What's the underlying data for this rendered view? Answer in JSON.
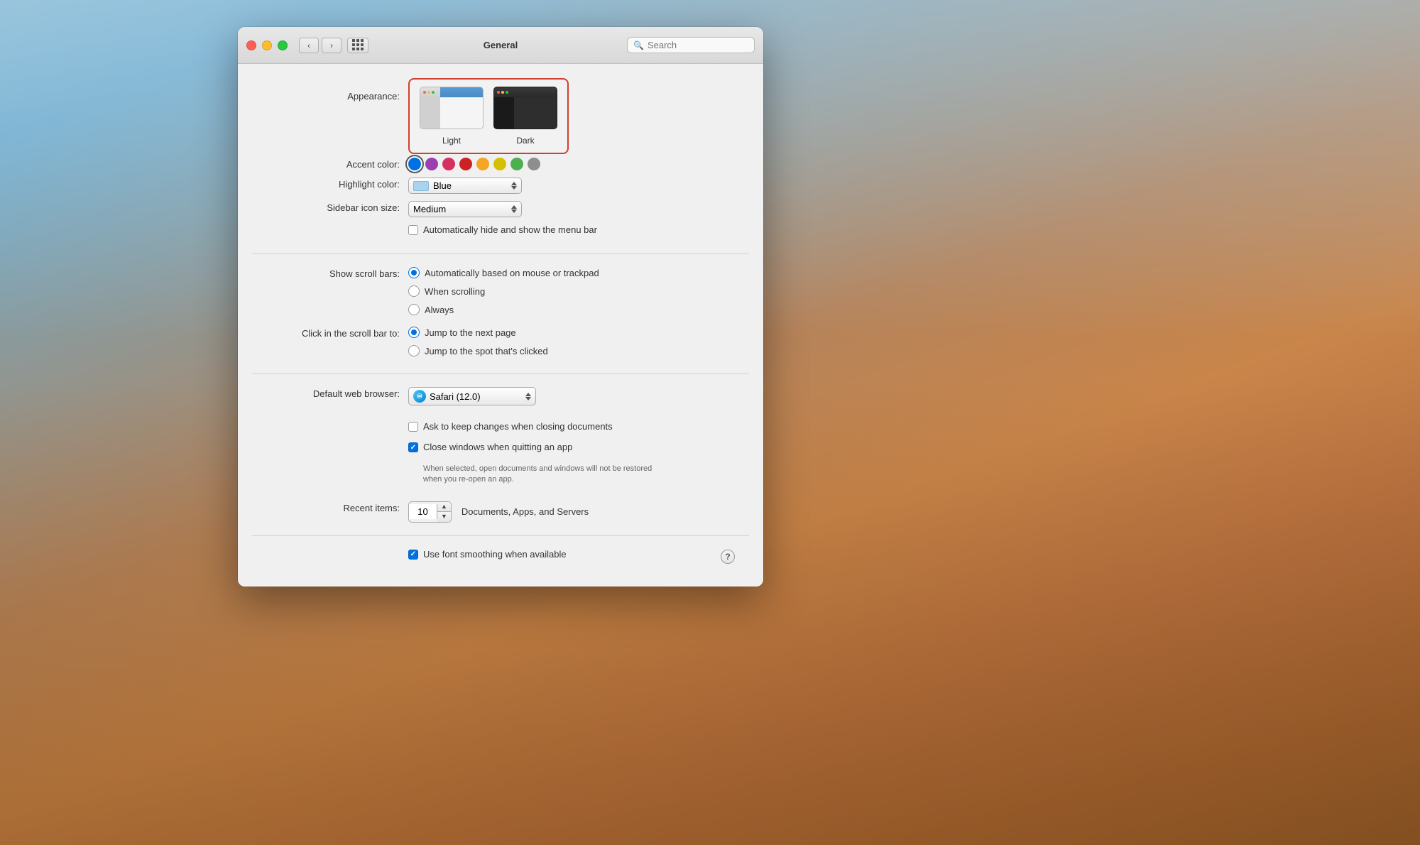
{
  "desktop": {
    "bg": "mojave"
  },
  "window": {
    "title": "General",
    "traffic_lights": {
      "close": "close",
      "minimize": "minimize",
      "maximize": "maximize"
    },
    "search_placeholder": "Search",
    "search_value": ""
  },
  "appearance": {
    "label": "Appearance:",
    "options": [
      {
        "id": "light",
        "label": "Light"
      },
      {
        "id": "dark",
        "label": "Dark"
      }
    ],
    "selected": "dark"
  },
  "accent_color": {
    "label": "Accent color:",
    "colors": [
      {
        "id": "blue",
        "hex": "#0071e3",
        "selected": true
      },
      {
        "id": "purple",
        "hex": "#9a40b0"
      },
      {
        "id": "pink",
        "hex": "#d63060"
      },
      {
        "id": "red",
        "hex": "#cc2222"
      },
      {
        "id": "orange",
        "hex": "#f5a623"
      },
      {
        "id": "yellow",
        "hex": "#d4c000"
      },
      {
        "id": "green",
        "hex": "#4caf50"
      },
      {
        "id": "graphite",
        "hex": "#8e8e8e"
      }
    ]
  },
  "highlight_color": {
    "label": "Highlight color:",
    "value": "Blue",
    "swatch": "#a8d4f0"
  },
  "sidebar_icon_size": {
    "label": "Sidebar icon size:",
    "value": "Medium"
  },
  "menu_bar": {
    "label": "",
    "checkbox_label": "Automatically hide and show the menu bar",
    "checked": false
  },
  "show_scroll_bars": {
    "label": "Show scroll bars:",
    "options": [
      {
        "id": "auto",
        "label": "Automatically based on mouse or trackpad",
        "selected": true
      },
      {
        "id": "scrolling",
        "label": "When scrolling",
        "selected": false
      },
      {
        "id": "always",
        "label": "Always",
        "selected": false
      }
    ]
  },
  "click_scroll_bar": {
    "label": "Click in the scroll bar to:",
    "options": [
      {
        "id": "next_page",
        "label": "Jump to the next page",
        "selected": true
      },
      {
        "id": "spot",
        "label": "Jump to the spot that's clicked",
        "selected": false
      }
    ]
  },
  "default_browser": {
    "label": "Default web browser:",
    "value": "Safari (12.0)"
  },
  "documents": {
    "ask_changes": {
      "label": "Ask to keep changes when closing documents",
      "checked": false
    },
    "close_windows": {
      "label": "Close windows when quitting an app",
      "checked": true
    },
    "sub_text": "When selected, open documents and windows will not be restored\nwhen you re-open an app."
  },
  "recent_items": {
    "label": "Recent items:",
    "value": "10",
    "suffix": "Documents, Apps, and Servers"
  },
  "font_smoothing": {
    "label": "Use font smoothing when available",
    "checked": true
  }
}
